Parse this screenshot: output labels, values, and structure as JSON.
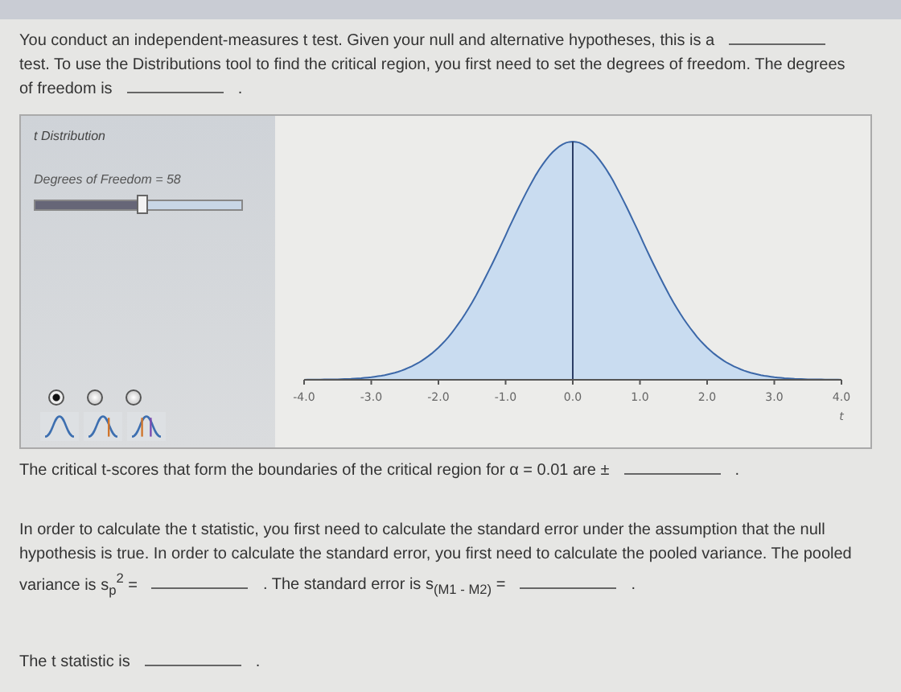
{
  "intro": [
    [
      {
        "kind": "text",
        "text": "You conduct an independent-measures t test. Given your null and alternative hypotheses, this is a"
      },
      {
        "kind": "blank"
      }
    ],
    [
      {
        "kind": "text",
        "text": "test. To use the Distributions tool to find the critical region, you first need to set the degrees of freedom. The degrees"
      }
    ],
    [
      {
        "kind": "text",
        "text": "of freedom is"
      },
      {
        "kind": "blank"
      },
      {
        "kind": "text",
        "text": "."
      }
    ]
  ],
  "tool": {
    "title": "t Distribution",
    "slider": {
      "label": "Degrees of Freedom = 58",
      "level": 0.52
    },
    "modes": [
      {
        "kind": "plain",
        "selected": true
      },
      {
        "kind": "one-tail",
        "selected": false
      },
      {
        "kind": "two-tail",
        "selected": false
      }
    ],
    "x_ticks": [
      "-4.0",
      "-3.0",
      "-2.0",
      "-1.0",
      "0.0",
      "1.0",
      "2.0",
      "3.0",
      "4.0"
    ],
    "axis_label": "t"
  },
  "critical": [
    [
      {
        "kind": "text",
        "text": "The critical t-scores that form the boundaries of the critical region for α = 0.01 are ±"
      },
      {
        "kind": "blank"
      },
      {
        "kind": "text",
        "text": "."
      }
    ]
  ],
  "standard_error": [
    [
      {
        "kind": "text",
        "text": "In order to calculate the t statistic, you first need to calculate the standard error under the assumption that the null"
      }
    ],
    [
      {
        "kind": "text",
        "text": "hypothesis is true. In order to calculate the standard error, you first need to calculate the pooled variance. The pooled"
      }
    ],
    [
      {
        "kind": "text",
        "text": "variance is s$_{p}$$^{2}$ ="
      },
      {
        "kind": "blank"
      },
      {
        "kind": "text",
        "text": ". The standard error is s$_{(M1 - M2)}$ ="
      },
      {
        "kind": "blank"
      },
      {
        "kind": "text",
        "text": "."
      }
    ]
  ],
  "t_statistic": [
    [
      {
        "kind": "text",
        "text": "The t statistic is"
      },
      {
        "kind": "blank"
      },
      {
        "kind": "text",
        "text": "."
      }
    ]
  ]
}
